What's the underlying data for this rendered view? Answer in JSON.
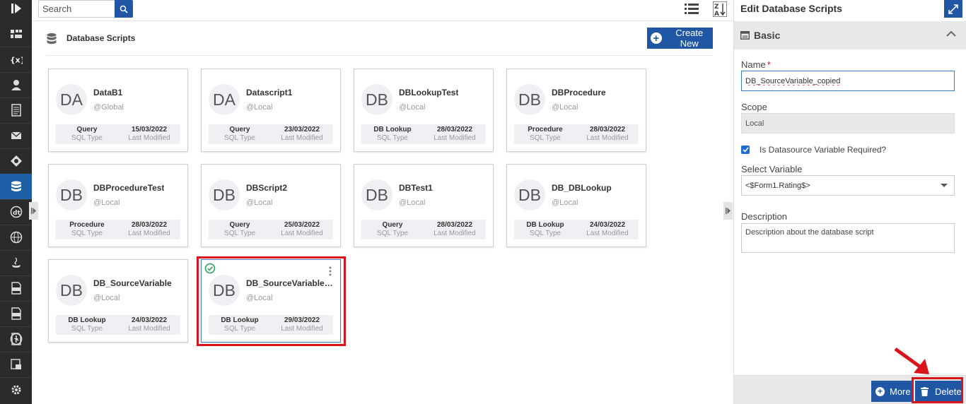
{
  "search": {
    "placeholder": "Search"
  },
  "header": {
    "title": "Database Scripts",
    "create_label": "Create New"
  },
  "cards": [
    {
      "initials": "DA",
      "name": "DataB1",
      "scope": "@Global",
      "type": "Query",
      "type_label": "SQL Type",
      "date": "15/03/2022",
      "date_label": "Last Modified"
    },
    {
      "initials": "DA",
      "name": "Datascript1",
      "scope": "@Local",
      "type": "Query",
      "type_label": "SQL Type",
      "date": "23/03/2022",
      "date_label": "Last Modified"
    },
    {
      "initials": "DB",
      "name": "DBLookupTest",
      "scope": "@Local",
      "type": "DB Lookup",
      "type_label": "SQL Type",
      "date": "28/03/2022",
      "date_label": "Last Modified"
    },
    {
      "initials": "DB",
      "name": "DBProcedure",
      "scope": "@Local",
      "type": "Procedure",
      "type_label": "SQL Type",
      "date": "28/03/2022",
      "date_label": "Last Modified"
    },
    {
      "initials": "DB",
      "name": "DBProcedureTest",
      "scope": "@Local",
      "type": "Procedure",
      "type_label": "SQL Type",
      "date": "28/03/2022",
      "date_label": "Last Modified"
    },
    {
      "initials": "DB",
      "name": "DBScript2",
      "scope": "@Local",
      "type": "Query",
      "type_label": "SQL Type",
      "date": "25/03/2022",
      "date_label": "Last Modified"
    },
    {
      "initials": "DB",
      "name": "DBTest1",
      "scope": "@Local",
      "type": "Query",
      "type_label": "SQL Type",
      "date": "28/03/2022",
      "date_label": "Last Modified"
    },
    {
      "initials": "DB",
      "name": "DB_DBLookup",
      "scope": "@Local",
      "type": "DB Lookup",
      "type_label": "SQL Type",
      "date": "24/03/2022",
      "date_label": "Last Modified"
    },
    {
      "initials": "DB",
      "name": "DB_SourceVariable",
      "scope": "@Local",
      "type": "DB Lookup",
      "type_label": "SQL Type",
      "date": "24/03/2022",
      "date_label": "Last Modified"
    },
    {
      "initials": "DB",
      "name": "DB_SourceVariable_c...",
      "scope": "@Local",
      "type": "DB Lookup",
      "type_label": "SQL Type",
      "date": "29/03/2022",
      "date_label": "Last Modified",
      "selected": true
    }
  ],
  "panel": {
    "title": "Edit Database Scripts",
    "section": "Basic",
    "name_label": "Name",
    "name_required": "*",
    "name_value": "DB_SourceVariable_copied",
    "scope_label": "Scope",
    "scope_value": "Local",
    "checkbox_label": "Is Datasource Variable Required?",
    "checkbox_checked": true,
    "select_label": "Select Variable",
    "select_value": "<$Form1.Rating$>",
    "description_label": "Description",
    "description_value": "Description about the database script",
    "more_label": "More",
    "delete_label": "Delete"
  },
  "colors": {
    "accent": "#1f57a5",
    "nav_bg": "#2b2b2b",
    "nav_active": "#1e5fa8",
    "annotation": "#d9151b"
  },
  "nav_icons": [
    "logo-icon",
    "dashboard-icon",
    "variables-icon",
    "user-icon",
    "document-icon",
    "mail-icon",
    "process-icon",
    "database-icon",
    "datatype-icon",
    "globe-icon",
    "java-icon",
    "js-file-icon",
    "css-file-icon",
    "text-file-icon",
    "clock-icon",
    "report-icon",
    "settings-icon"
  ]
}
